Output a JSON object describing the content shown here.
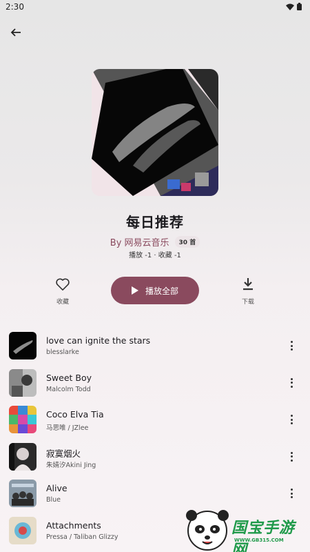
{
  "status": {
    "time": "2:30"
  },
  "playlist": {
    "title": "每日推荐",
    "byline": "By 网易云音乐",
    "count": "30 首",
    "stats": "播放 -1 · 收藏 -1"
  },
  "actions": {
    "favorite_label": "收藏",
    "play_all_label": "播放全部",
    "download_label": "下载"
  },
  "songs": [
    {
      "title": "love can ignite the stars",
      "artist": "blesslarke"
    },
    {
      "title": "Sweet Boy",
      "artist": "Malcolm Todd"
    },
    {
      "title": "Coco Elva Tia",
      "artist": "马思唯 / JZlee"
    },
    {
      "title": "寂寞烟火",
      "artist": "朱婧汐Akini Jing"
    },
    {
      "title": "Alive",
      "artist": "Blue"
    },
    {
      "title": "Attachments",
      "artist": "Pressa / Taliban Glizzy"
    }
  ],
  "watermark": {
    "text": "国宝手游网",
    "url": "WWW.GB315.COM"
  },
  "colors": {
    "accent": "#8a4a5e",
    "watermark": "#1f9a4a"
  }
}
